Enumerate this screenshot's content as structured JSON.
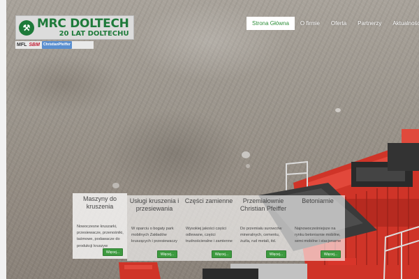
{
  "logo": {
    "title": "MRC DOLTECH",
    "subtitle": "20 LAT DOLTECHU",
    "mark_glyph": "⚒"
  },
  "partners": [
    {
      "label": "MFL"
    },
    {
      "label": "SBM"
    },
    {
      "label": "ChristianPfeiffer"
    }
  ],
  "nav": {
    "items": [
      {
        "label": "Strona Główna",
        "active": true
      },
      {
        "label": "O firmie"
      },
      {
        "label": "Oferta"
      },
      {
        "label": "Partnerzy"
      },
      {
        "label": "Aktualności"
      }
    ]
  },
  "cards": [
    {
      "title": "Maszyny do kruszenia",
      "text": "Nowoczesne kruszarki, przesiewacze, przenośniki, taśmowe, podawacze do produkcji kruszyw",
      "button": "Więcej..."
    },
    {
      "title": "Usługi kruszenia i przesiewania",
      "text": "W oparciu o bogaty park mobilnych Zakładów kruszących i przesiewaczy",
      "button": "Więcej..."
    },
    {
      "title": "Części zamienne",
      "text": "Wysokiej jakości części odlewane, części trudnościeralne i zamienne",
      "button": "Więcej..."
    },
    {
      "title": "Przemiałownie Christian Pfeiffer",
      "text": "Do przemiału surowców mineralnych, cementu, żużla, rud metali, itd.",
      "button": "Więcej..."
    },
    {
      "title": "Betoniarnie",
      "text": "Najnowocześniejsze na rynku betoniarnie mobilne, semi mobilne i stacjonarne",
      "button": "Więcej..."
    }
  ],
  "colors": {
    "brand_green": "#1e7a3a",
    "button_green": "#3d9a3f",
    "nav_active_text": "#2f8f3a",
    "machine_red": "#d8352a"
  }
}
